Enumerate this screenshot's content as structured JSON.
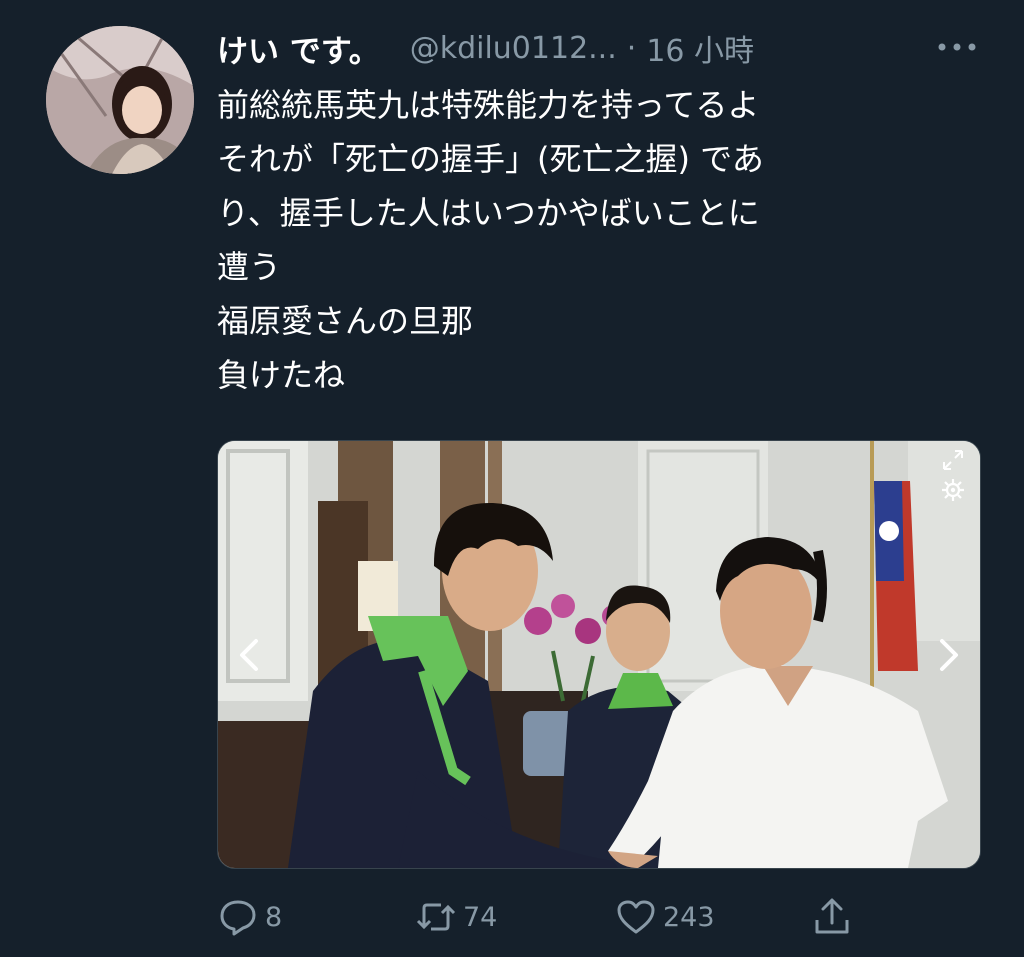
{
  "tweet": {
    "display_name": "けい です。",
    "handle": "@kdilu0112...",
    "separator": "·",
    "time": "16 小時",
    "lines": [
      "前総統馬英九は特殊能力を持ってるよ",
      "それが「死亡の握手」(死亡之握) であ",
      "り、握手した人はいつかやばいことに",
      "遭う",
      "福原愛さんの旦那",
      "負けたね"
    ],
    "media": {
      "expand_icon": "expand-icon",
      "settings_icon": "gear-icon",
      "prev_icon": "chevron-left-icon",
      "next_icon": "chevron-right-icon"
    },
    "actions": {
      "reply_count": "8",
      "retweet_count": "74",
      "like_count": "243"
    }
  },
  "colors": {
    "background": "#15202b",
    "secondary_text": "#8899a6",
    "primary_text": "#ffffff"
  }
}
